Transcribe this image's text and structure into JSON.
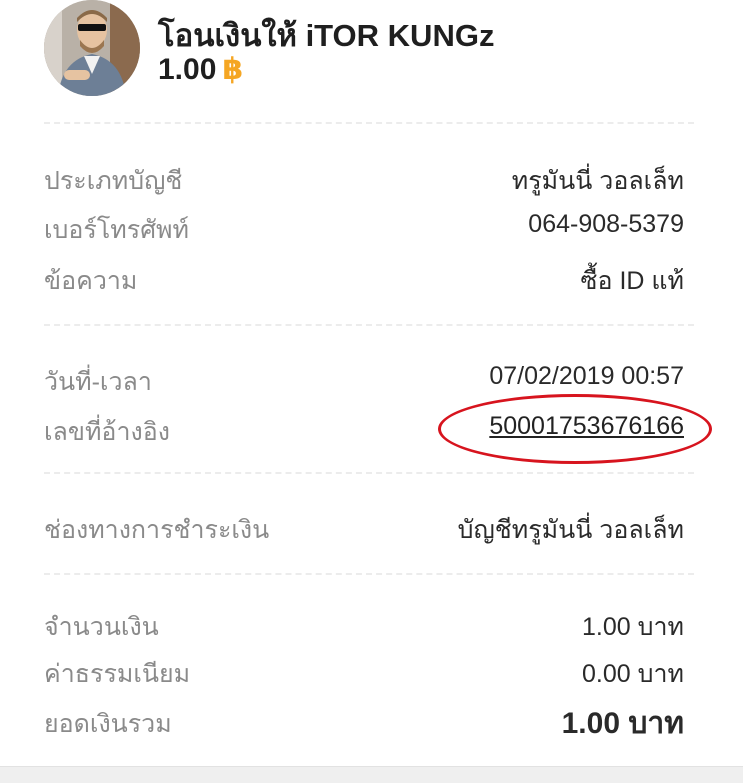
{
  "header": {
    "title": "โอนเงินให้ iTOR KUNGz",
    "amount": "1.00",
    "currency_symbol": "฿",
    "currency_color": "#f5a623"
  },
  "account": {
    "type_label": "ประเภทบัญชี",
    "type_value": "ทรูมันนี่ วอลเล็ท",
    "phone_label": "เบอร์โทรศัพท์",
    "phone_value": "064-908-5379",
    "message_label": "ข้อความ",
    "message_value": "ซื้อ ID แท้"
  },
  "transaction": {
    "datetime_label": "วันที่-เวลา",
    "datetime_value": "07/02/2019 00:57",
    "reference_label": "เลขที่อ้างอิง",
    "reference_value": "50001753676166",
    "highlight_color": "#d7141e"
  },
  "payment": {
    "channel_label": "ช่องทางการชำระเงิน",
    "channel_value": "บัญชีทรูมันนี่ วอลเล็ท"
  },
  "summary": {
    "amount_label": "จำนวนเงิน",
    "amount_value": "1.00 บาท",
    "fee_label": "ค่าธรรมเนียม",
    "fee_value": "0.00 บาท",
    "total_label": "ยอดเงินรวม",
    "total_value": "1.00 บาท"
  }
}
